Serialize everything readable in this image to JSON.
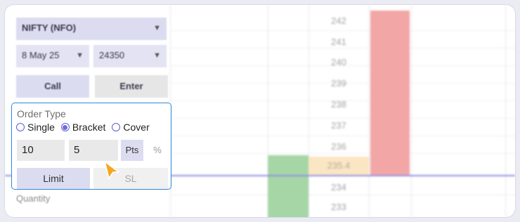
{
  "symbol": {
    "value": "NIFTY (NFO)"
  },
  "expiry": {
    "value": "8 May 25"
  },
  "strike": {
    "value": "24350"
  },
  "actions": {
    "call": "Call",
    "enter": "Enter"
  },
  "order_type": {
    "title": "Order Type",
    "options": [
      {
        "label": "Single",
        "selected": false
      },
      {
        "label": "Bracket",
        "selected": true
      },
      {
        "label": "Cover",
        "selected": false
      }
    ],
    "target_value": "10",
    "stoploss_value": "5",
    "unit_points": "Pts",
    "unit_percent": "%",
    "limit_label": "Limit",
    "sl_label": "SL"
  },
  "quantity_label": "Quantity",
  "ladder": {
    "prices": [
      "242",
      "241",
      "240",
      "239",
      "238",
      "237",
      "236",
      "235.4",
      "234",
      "233"
    ],
    "ltp": "235.4"
  },
  "colors": {
    "accent": "#2f87d8",
    "sell": "#f2a6a6",
    "buy": "#a6d5a6",
    "ltp_highlight": "#fbe6c4",
    "ltp_line": "#8f8fe6",
    "cursor": "#f5a623"
  },
  "icons": {
    "dropdown": "chevron-down-icon",
    "pointer": "cursor-arrow-icon"
  }
}
